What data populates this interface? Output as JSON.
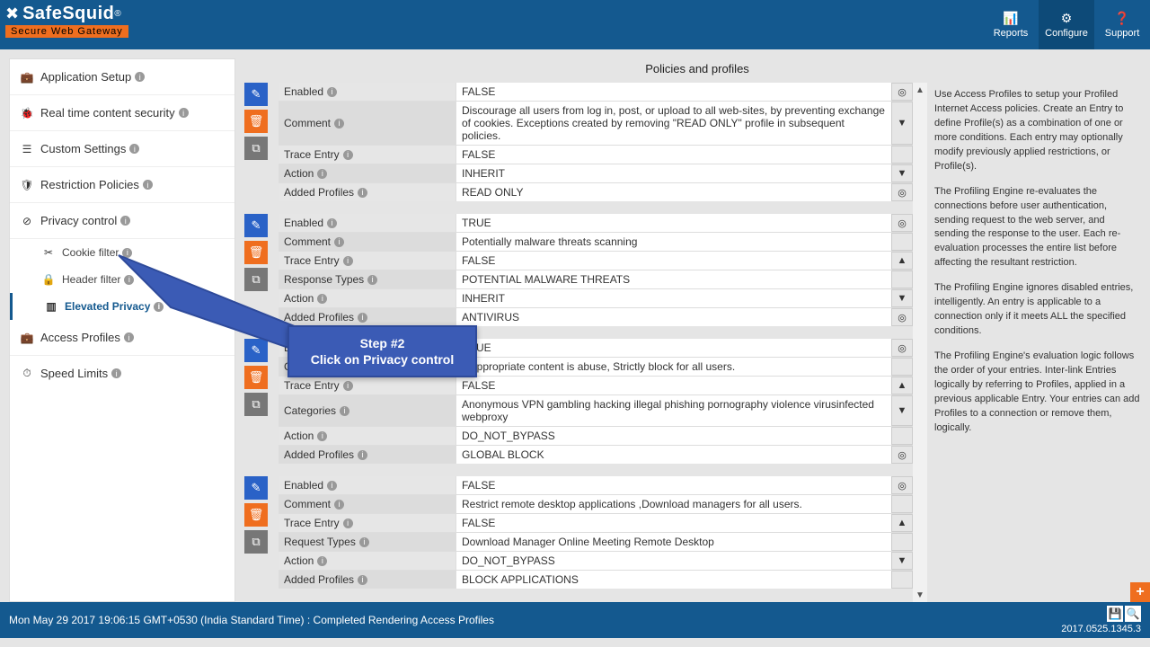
{
  "header": {
    "logo_text": "SafeSquid",
    "logo_reg": "®",
    "logo_sub": "Secure Web Gateway",
    "buttons": [
      {
        "label": "Reports"
      },
      {
        "label": "Configure"
      },
      {
        "label": "Support"
      }
    ]
  },
  "sidebar": {
    "items": [
      {
        "label": "Application Setup"
      },
      {
        "label": "Real time content security"
      },
      {
        "label": "Custom Settings"
      },
      {
        "label": "Restriction Policies"
      },
      {
        "label": "Privacy control"
      },
      {
        "label": "Access Profiles"
      },
      {
        "label": "Speed Limits"
      }
    ],
    "sub": [
      {
        "label": "Cookie filter"
      },
      {
        "label": "Header filter"
      },
      {
        "label": "Elevated Privacy"
      }
    ]
  },
  "center": {
    "title": "Policies and profiles"
  },
  "policies": [
    {
      "rows": [
        {
          "label": "Enabled",
          "value": "FALSE",
          "ctrl": "target"
        },
        {
          "label": "Comment",
          "value": "Discourage all users from log in, post, or upload to all web-sites, by preventing exchange of cookies.\nExceptions created by removing \"READ ONLY\" profile in subsequent policies.",
          "ctrl": "down"
        },
        {
          "label": "Trace Entry",
          "value": "FALSE",
          "ctrl": ""
        },
        {
          "label": "Action",
          "value": "INHERIT",
          "ctrl": "down"
        },
        {
          "label": "Added Profiles",
          "value": "READ ONLY",
          "ctrl": "target"
        }
      ]
    },
    {
      "rows": [
        {
          "label": "Enabled",
          "value": "TRUE",
          "ctrl": "target"
        },
        {
          "label": "Comment",
          "value": "Potentially malware threats scanning",
          "ctrl": ""
        },
        {
          "label": "Trace Entry",
          "value": "FALSE",
          "ctrl": "up"
        },
        {
          "label": "Response Types",
          "value": "POTENTIAL MALWARE THREATS",
          "ctrl": ""
        },
        {
          "label": "Action",
          "value": "INHERIT",
          "ctrl": "down"
        },
        {
          "label": "Added Profiles",
          "value": "ANTIVIRUS",
          "ctrl": "target"
        }
      ]
    },
    {
      "rows": [
        {
          "label": "Enabled",
          "value": "TRUE",
          "ctrl": "target"
        },
        {
          "label": "Comment",
          "value": "Inappropriate content is abuse, Strictly block for all users.",
          "ctrl": ""
        },
        {
          "label": "Trace Entry",
          "value": "FALSE",
          "ctrl": "up"
        },
        {
          "label": "Categories",
          "value": "Anonymous VPN   gambling   hacking   illegal   phishing   pornography   violence   virusinfected   webproxy",
          "ctrl": "down"
        },
        {
          "label": "Action",
          "value": "DO_NOT_BYPASS",
          "ctrl": ""
        },
        {
          "label": "Added Profiles",
          "value": "GLOBAL BLOCK",
          "ctrl": "target"
        }
      ]
    },
    {
      "rows": [
        {
          "label": "Enabled",
          "value": "FALSE",
          "ctrl": "target"
        },
        {
          "label": "Comment",
          "value": "Restrict remote desktop applications ,Download managers for all users.",
          "ctrl": ""
        },
        {
          "label": "Trace Entry",
          "value": "FALSE",
          "ctrl": "up"
        },
        {
          "label": "Request Types",
          "value": "Download Manager   Online Meeting   Remote Desktop",
          "ctrl": ""
        },
        {
          "label": "Action",
          "value": "DO_NOT_BYPASS",
          "ctrl": "down"
        },
        {
          "label": "Added Profiles",
          "value": "BLOCK APPLICATIONS",
          "ctrl": ""
        }
      ]
    }
  ],
  "help": {
    "p1": "Use Access Profiles to setup your Profiled Internet Access policies. Create an Entry to define Profile(s) as a combination of one or more conditions. Each entry may optionally modify previously applied restrictions, or Profile(s).",
    "p2": "The Profiling Engine re-evaluates the connections before user authentication, sending request to the web server, and sending the response to the user. Each re-evaluation processes the entire list before affecting the resultant restriction.",
    "p3": "The Profiling Engine ignores disabled entries, intelligently. An entry is applicable to a connection only if it meets ALL the specified conditions.",
    "p4": "The Profiling Engine's evaluation logic follows the order of your entries. Inter-link Entries logically by referring to Profiles, applied in a previous applicable Entry. Your entries can add Profiles to a connection or remove them, logically."
  },
  "callout": {
    "title": "Step #2",
    "text": "Click on Privacy control"
  },
  "footer": {
    "status": "Mon May 29 2017 19:06:15 GMT+0530 (India Standard Time) : Completed Rendering Access Profiles",
    "version": "2017.0525.1345.3"
  },
  "icons": {
    "save": "💾",
    "search": "🔍",
    "add": "+"
  },
  "ctrl_glyphs": {
    "target": "◎",
    "up": "▲",
    "down": "▼",
    "": ""
  }
}
